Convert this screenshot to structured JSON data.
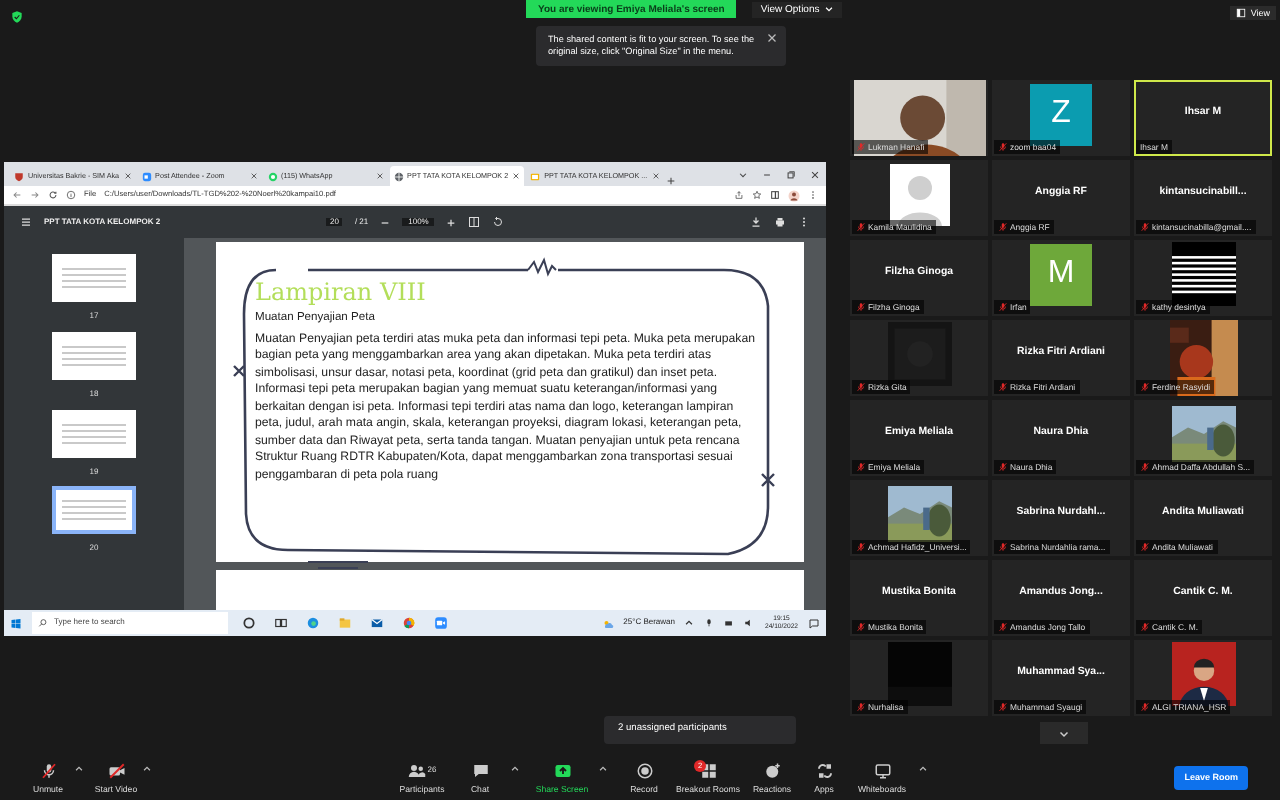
{
  "banner": {
    "text": "You are viewing Emiya Meliala's screen",
    "options": "View Options"
  },
  "notice": {
    "text": "The shared content is fit to your screen. To see the original size, click \"Original Size\" in the menu."
  },
  "view_button": "View",
  "shared_screen": {
    "browser_tabs": [
      {
        "title": "Universitas Bakrie - SIM Aka",
        "selected": false
      },
      {
        "title": "Post Attendee - Zoom",
        "selected": false
      },
      {
        "title": "(115) WhatsApp",
        "selected": false
      },
      {
        "title": "PPT TATA KOTA KELOMPOK 2",
        "selected": true
      },
      {
        "title": "PPT TATA KOTA KELOMPOK ...",
        "selected": false
      }
    ],
    "address": {
      "scheme": "File",
      "url": "C:/Users/user/Downloads/TL-TGD%202-%20Noerl%20kampai10.pdf"
    },
    "pdf_toolbar": {
      "title": "PPT TATA KOTA KELOMPOK 2",
      "page": "20",
      "page_count": "/ 21",
      "zoom": "100%"
    },
    "thumbnails": [
      {
        "label": "17",
        "selected": false
      },
      {
        "label": "18",
        "selected": false
      },
      {
        "label": "19",
        "selected": false
      },
      {
        "label": "20",
        "selected": true
      }
    ],
    "page": {
      "title": "Lampiran VIII",
      "heading": "Muatan Penyajian Peta",
      "body": "Muatan Penyajian peta terdiri atas muka peta dan informasi tepi peta. Muka peta merupakan bagian peta yang menggambarkan area yang akan dipetakan. Muka peta terdiri atas simbolisasi, unsur dasar, notasi peta, koordinat (grid peta dan gratikul) dan inset peta. Informasi tepi peta merupakan bagian yang memuat suatu keterangan/informasi yang berkaitan dengan isi peta. Informasi tepi terdiri atas nama dan logo, keterangan lampiran peta, judul, arah mata angin, skala, keterangan proyeksi, diagram lokasi, keterangan peta, sumber data dan Riwayat peta, serta tanda tangan. Muatan penyajian untuk peta rencana Struktur Ruang RDTR Kabupaten/Kota, dapat menggambarkan zona transportasi sesuai penggambaran di peta pola ruang"
    },
    "taskbar": {
      "search_placeholder": "Type here to search",
      "weather": "25°C  Berawan",
      "time": "19:15",
      "date": "24/10/2022"
    }
  },
  "gallery": [
    {
      "kind": "picture",
      "label": "Lukman Hanafi",
      "muted": true,
      "speaking": false
    },
    {
      "kind": "avatar",
      "letter": "Z",
      "color": "#0b9cb0",
      "label": "zoom baa04",
      "muted": true,
      "speaking": false
    },
    {
      "kind": "name",
      "display": "Ihsar M",
      "label": "Ihsar M",
      "muted": false,
      "speaking": true
    },
    {
      "kind": "silhouette",
      "label": "Kamila Maulidina",
      "muted": true,
      "speaking": false
    },
    {
      "kind": "name",
      "display": "Anggia RF",
      "label": "Anggia RF",
      "muted": true,
      "speaking": false
    },
    {
      "kind": "name",
      "display": "kintansucinabill...",
      "label": "kintansucinabilla@gmail....",
      "muted": true,
      "speaking": false
    },
    {
      "kind": "name",
      "display": "Filzha Ginoga",
      "label": "Filzha Ginoga",
      "muted": true,
      "speaking": false
    },
    {
      "kind": "avatar",
      "letter": "M",
      "color": "#6ea83a",
      "label": "Irfan",
      "muted": true,
      "speaking": false
    },
    {
      "kind": "picture",
      "label": "kathy desintya",
      "muted": true,
      "speaking": false
    },
    {
      "kind": "picture",
      "label": "Rizka Gita",
      "muted": true,
      "speaking": false
    },
    {
      "kind": "name",
      "display": "Rizka Fitri Ardiani",
      "label": "Rizka Fitri Ardiani",
      "muted": true,
      "speaking": false
    },
    {
      "kind": "picture",
      "label": "Ferdine Rasyidi",
      "muted": true,
      "speaking": false
    },
    {
      "kind": "name",
      "display": "Emiya Meliala",
      "label": "Emiya Meliala",
      "muted": true,
      "speaking": false
    },
    {
      "kind": "name",
      "display": "Naura Dhia",
      "label": "Naura Dhia",
      "muted": true,
      "speaking": false
    },
    {
      "kind": "picture",
      "label": "Ahmad Daffa Abdullah S...",
      "muted": true,
      "speaking": false
    },
    {
      "kind": "picture",
      "label": "Achmad Hafidz_Universi...",
      "muted": true,
      "speaking": false
    },
    {
      "kind": "name",
      "display": "Sabrina  Nurdahl...",
      "label": "Sabrina Nurdahlia rama...",
      "muted": true,
      "speaking": false
    },
    {
      "kind": "name",
      "display": "Andita Muliawati",
      "label": "Andita Muliawati",
      "muted": true,
      "speaking": false
    },
    {
      "kind": "name",
      "display": "Mustika Bonita",
      "label": "Mustika Bonita",
      "muted": true,
      "speaking": false
    },
    {
      "kind": "name",
      "display": "Amandus  Jong...",
      "label": "Amandus Jong Tallo",
      "muted": true,
      "speaking": false
    },
    {
      "kind": "name",
      "display": "Cantik C. M.",
      "label": "Cantik C. M.",
      "muted": true,
      "speaking": false
    },
    {
      "kind": "picture",
      "label": "Nurhalisa",
      "muted": true,
      "speaking": false
    },
    {
      "kind": "name",
      "display": "Muhammad  Sya...",
      "label": "Muhammad Syaugi",
      "muted": true,
      "speaking": false
    },
    {
      "kind": "picture",
      "label": "ALGI TRIANA_HSR",
      "muted": true,
      "speaking": false
    }
  ],
  "unassigned_popup": "2 unassigned participants",
  "toolbar": [
    {
      "kind": "mic",
      "label": "Unmute",
      "caret": true
    },
    {
      "kind": "video",
      "label": "Start Video",
      "caret": true
    },
    {
      "kind": "participants",
      "label": "Participants",
      "count": "26",
      "caret": false
    },
    {
      "kind": "chat",
      "label": "Chat",
      "caret": true
    },
    {
      "kind": "share",
      "label": "Share Screen",
      "caret": true
    },
    {
      "kind": "record",
      "label": "Record",
      "caret": false
    },
    {
      "kind": "breakout",
      "label": "Breakout Rooms",
      "badge": "2",
      "caret": false
    },
    {
      "kind": "reactions",
      "label": "Reactions",
      "caret": false
    },
    {
      "kind": "apps",
      "label": "Apps",
      "caret": false
    },
    {
      "kind": "whiteboard",
      "label": "Whiteboards",
      "caret": true
    }
  ],
  "leave_button": "Leave Room"
}
